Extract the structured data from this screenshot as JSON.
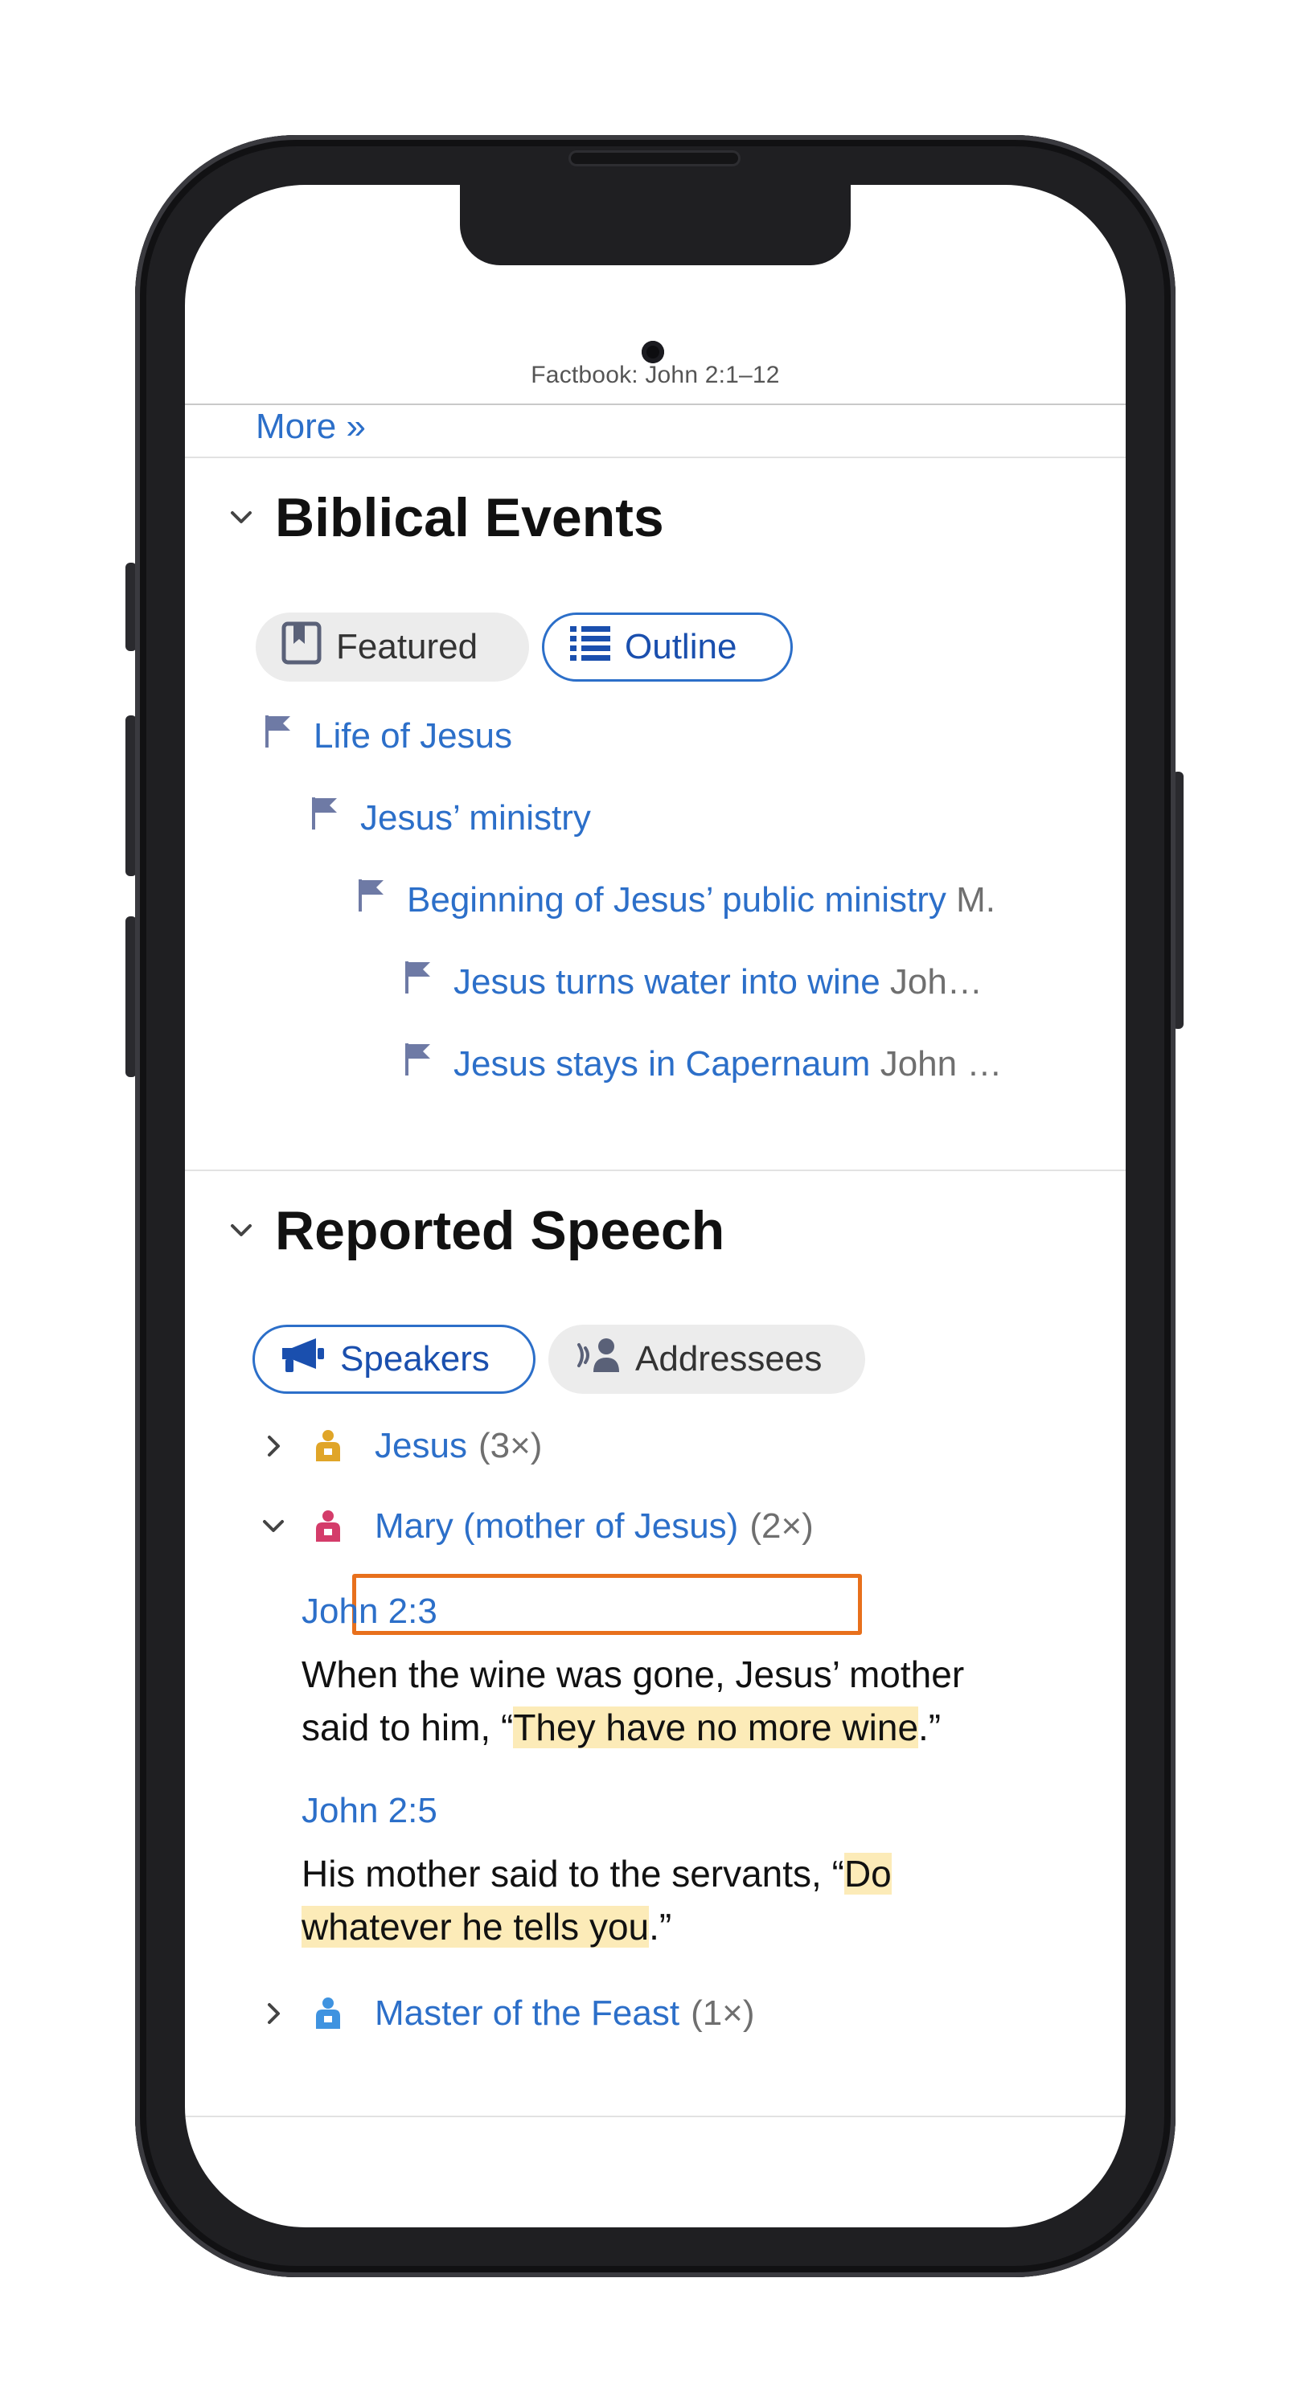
{
  "header": {
    "title": "Factbook: John 2:1–12"
  },
  "more_link": "More »",
  "biblical_events": {
    "title": "Biblical Events",
    "toggles": {
      "featured": "Featured",
      "outline": "Outline"
    },
    "outline": [
      {
        "label": "Life of Jesus",
        "ref": ""
      },
      {
        "label": "Jesus’ ministry",
        "ref": ""
      },
      {
        "label": "Beginning of Jesus’ public ministry",
        "ref": "M."
      },
      {
        "label": "Jesus turns water into wine",
        "ref": "Joh…"
      },
      {
        "label": "Jesus stays in Capernaum",
        "ref": "John …"
      }
    ]
  },
  "reported_speech": {
    "title": "Reported Speech",
    "toggles": {
      "speakers": "Speakers",
      "addressees": "Addressees"
    },
    "speakers": [
      {
        "name": "Jesus",
        "count": "(3×)",
        "color": "#e0a528",
        "expanded": false
      },
      {
        "name": "Mary (mother of Jesus)",
        "count": "(2×)",
        "color": "#d43c6a",
        "expanded": true
      },
      {
        "name": "Master of the Feast",
        "count": "(1×)",
        "color": "#3f93e0",
        "expanded": false
      }
    ],
    "mary_quotes": [
      {
        "ref": "John 2:3",
        "before": "When the wine was gone, Jesus’ mother said to him, “",
        "quote": "They have no more wine",
        "after": ".”"
      },
      {
        "ref": "John 2:5",
        "before": "His mother said to the servants, “",
        "quote": "Do whatever he tells you",
        "after": ".”"
      }
    ]
  },
  "colors": {
    "link": "#2c6fc9",
    "highlight": "#fcebb8",
    "focus_box": "#e8701c",
    "flag": "#6e7aa5"
  }
}
